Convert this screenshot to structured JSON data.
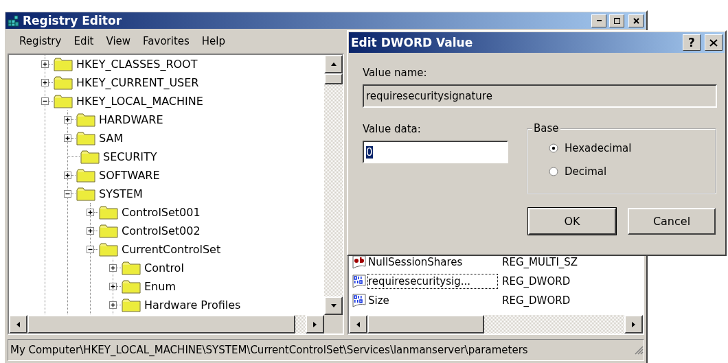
{
  "registry_window": {
    "title": "Registry Editor",
    "menu": [
      "Registry",
      "Edit",
      "View",
      "Favorites",
      "Help"
    ],
    "tree": [
      {
        "label": "HKEY_CLASSES_ROOT",
        "expandable": true,
        "expanded": false
      },
      {
        "label": "HKEY_CURRENT_USER",
        "expandable": true,
        "expanded": false
      },
      {
        "label": "HKEY_LOCAL_MACHINE",
        "expandable": true,
        "expanded": true,
        "children": [
          {
            "label": "HARDWARE",
            "expandable": true,
            "expanded": false
          },
          {
            "label": "SAM",
            "expandable": true,
            "expanded": false
          },
          {
            "label": "SECURITY",
            "expandable": false
          },
          {
            "label": "SOFTWARE",
            "expandable": true,
            "expanded": false
          },
          {
            "label": "SYSTEM",
            "expandable": true,
            "expanded": true,
            "children": [
              {
                "label": "ControlSet001",
                "expandable": true,
                "expanded": false
              },
              {
                "label": "ControlSet002",
                "expandable": true,
                "expanded": false
              },
              {
                "label": "CurrentControlSet",
                "expandable": true,
                "expanded": true,
                "children": [
                  {
                    "label": "Control",
                    "expandable": true,
                    "expanded": false
                  },
                  {
                    "label": "Enum",
                    "expandable": true,
                    "expanded": false
                  },
                  {
                    "label": "Hardware Profiles",
                    "expandable": true,
                    "expanded": false
                  }
                ]
              }
            ]
          }
        ]
      }
    ],
    "values": [
      {
        "name": "NullSessionShares",
        "type": "REG_MULTI_SZ",
        "kind": "string",
        "selected": false
      },
      {
        "name": "requiresecuritysig...",
        "type": "REG_DWORD",
        "kind": "binary",
        "selected": true
      },
      {
        "name": "Size",
        "type": "REG_DWORD",
        "kind": "binary",
        "selected": false
      }
    ],
    "status_bar": "My Computer\\HKEY_LOCAL_MACHINE\\SYSTEM\\CurrentControlSet\\Services\\lanmanserver\\parameters"
  },
  "dialog": {
    "title": "Edit DWORD Value",
    "help_button": "?",
    "value_name_label": "Value name:",
    "value_name": "requiresecuritysignature",
    "value_data_label": "Value data:",
    "value_data": "0",
    "base_label": "Base",
    "bases": [
      {
        "label": "Hexadecimal",
        "selected": true
      },
      {
        "label": "Decimal",
        "selected": false
      }
    ],
    "buttons": [
      {
        "label": "OK",
        "default": true
      },
      {
        "label": "Cancel",
        "default": false
      }
    ]
  }
}
